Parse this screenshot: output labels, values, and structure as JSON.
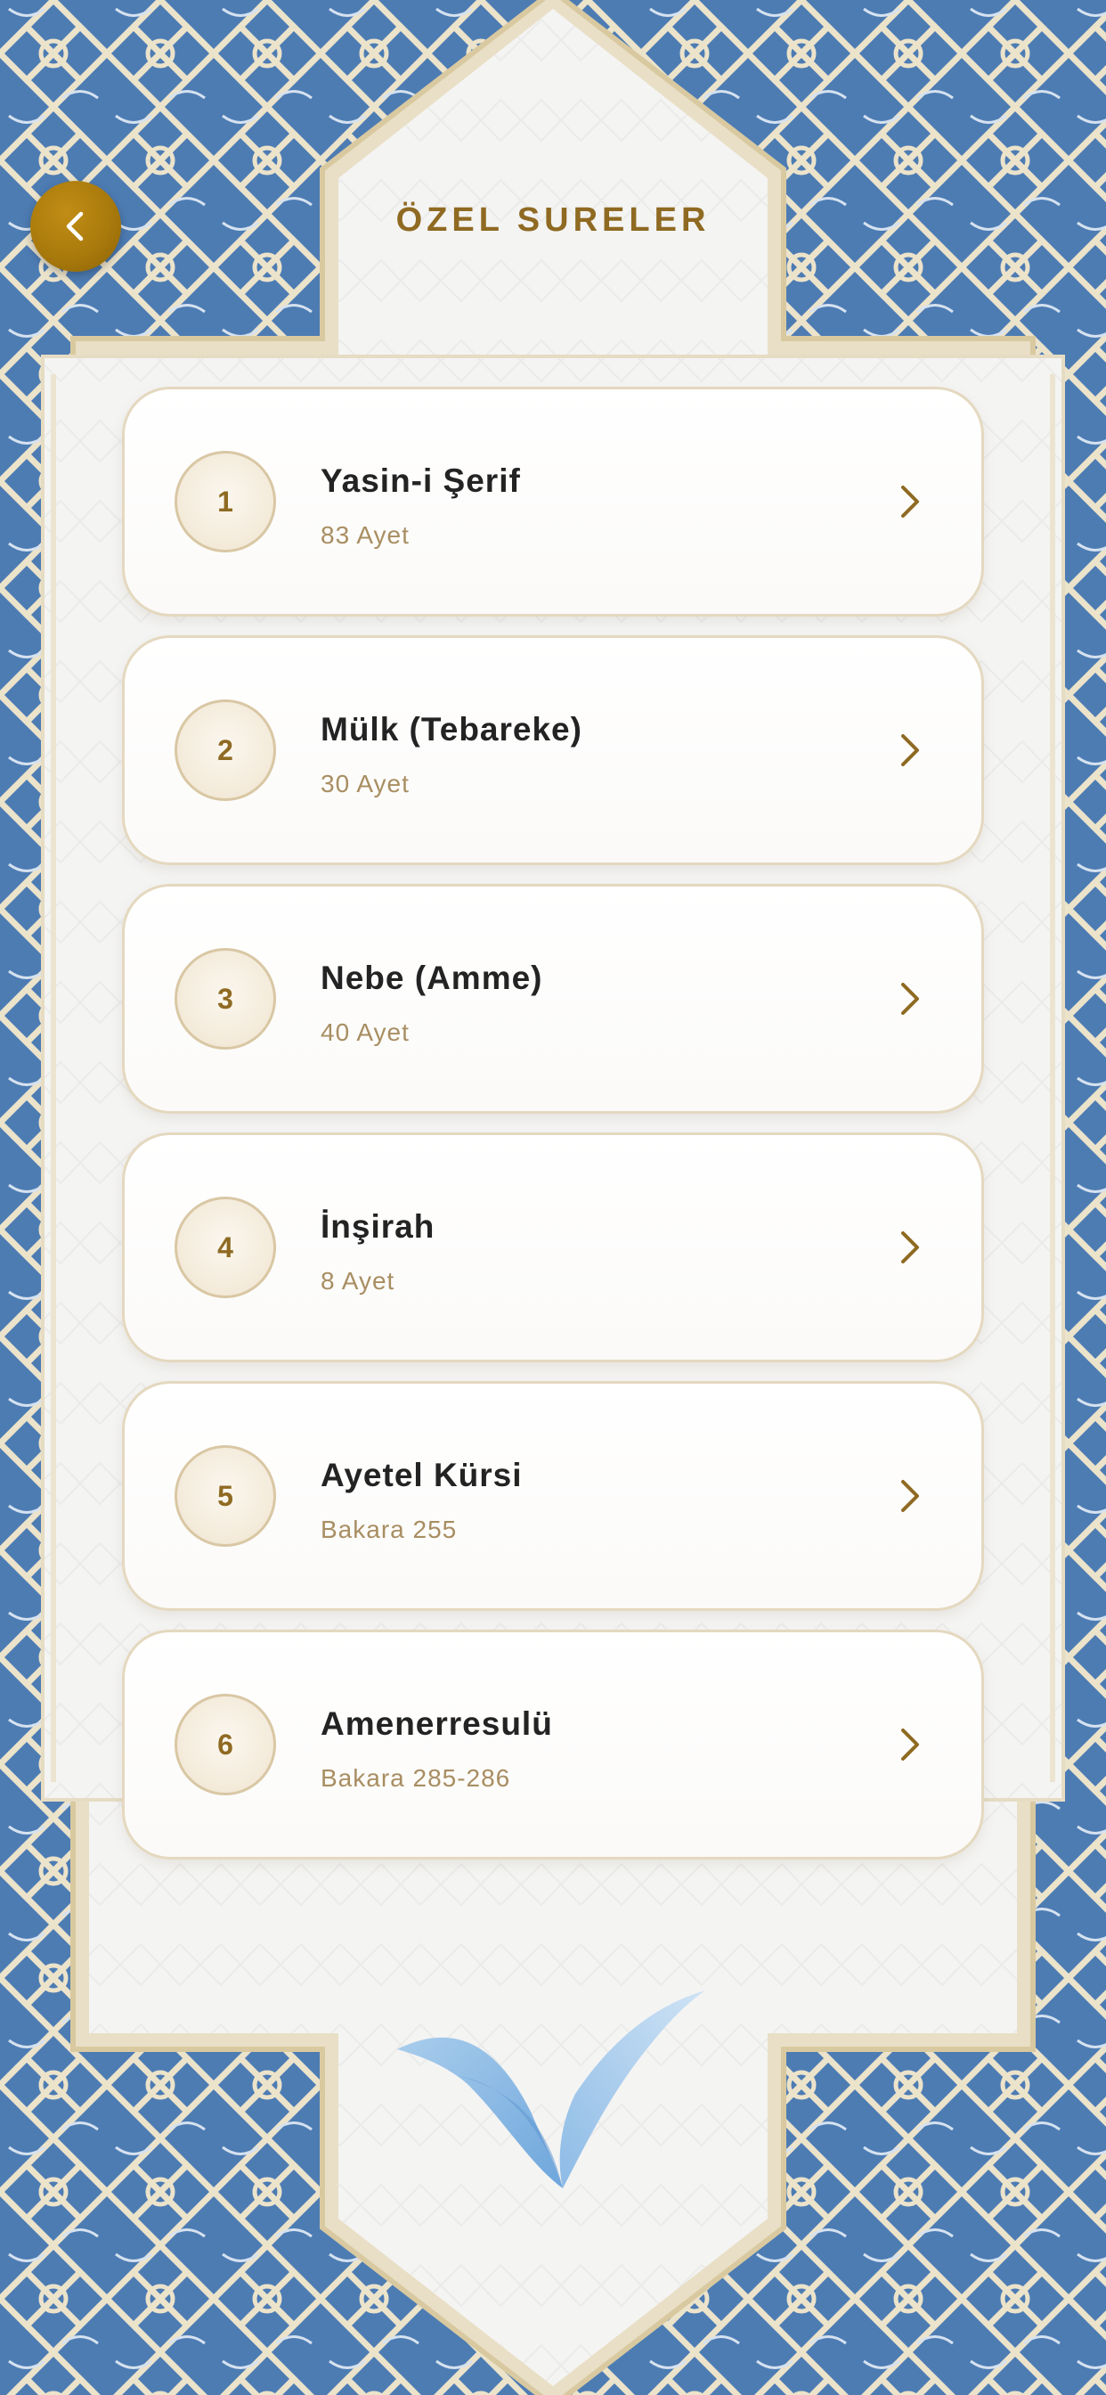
{
  "header": {
    "title": "ÖZEL SURELER",
    "back_icon": "chevron-left-icon"
  },
  "suras": [
    {
      "number": "1",
      "name": "Yasin-i Şerif",
      "detail": "83 Ayet"
    },
    {
      "number": "2",
      "name": "Mülk (Tebareke)",
      "detail": "30 Ayet"
    },
    {
      "number": "3",
      "name": "Nebe (Amme)",
      "detail": "40 Ayet"
    },
    {
      "number": "4",
      "name": "İnşirah",
      "detail": "8 Ayet"
    },
    {
      "number": "5",
      "name": "Ayetel Kürsi",
      "detail": "Bakara 255"
    },
    {
      "number": "6",
      "name": "Amenerresulü",
      "detail": "Bakara 285-286"
    }
  ],
  "colors": {
    "accent_gold": "#8f6a22",
    "ornament_blue": "#4a78b0",
    "ornament_cream": "#efe6cf",
    "background": "#f3f3f2"
  }
}
